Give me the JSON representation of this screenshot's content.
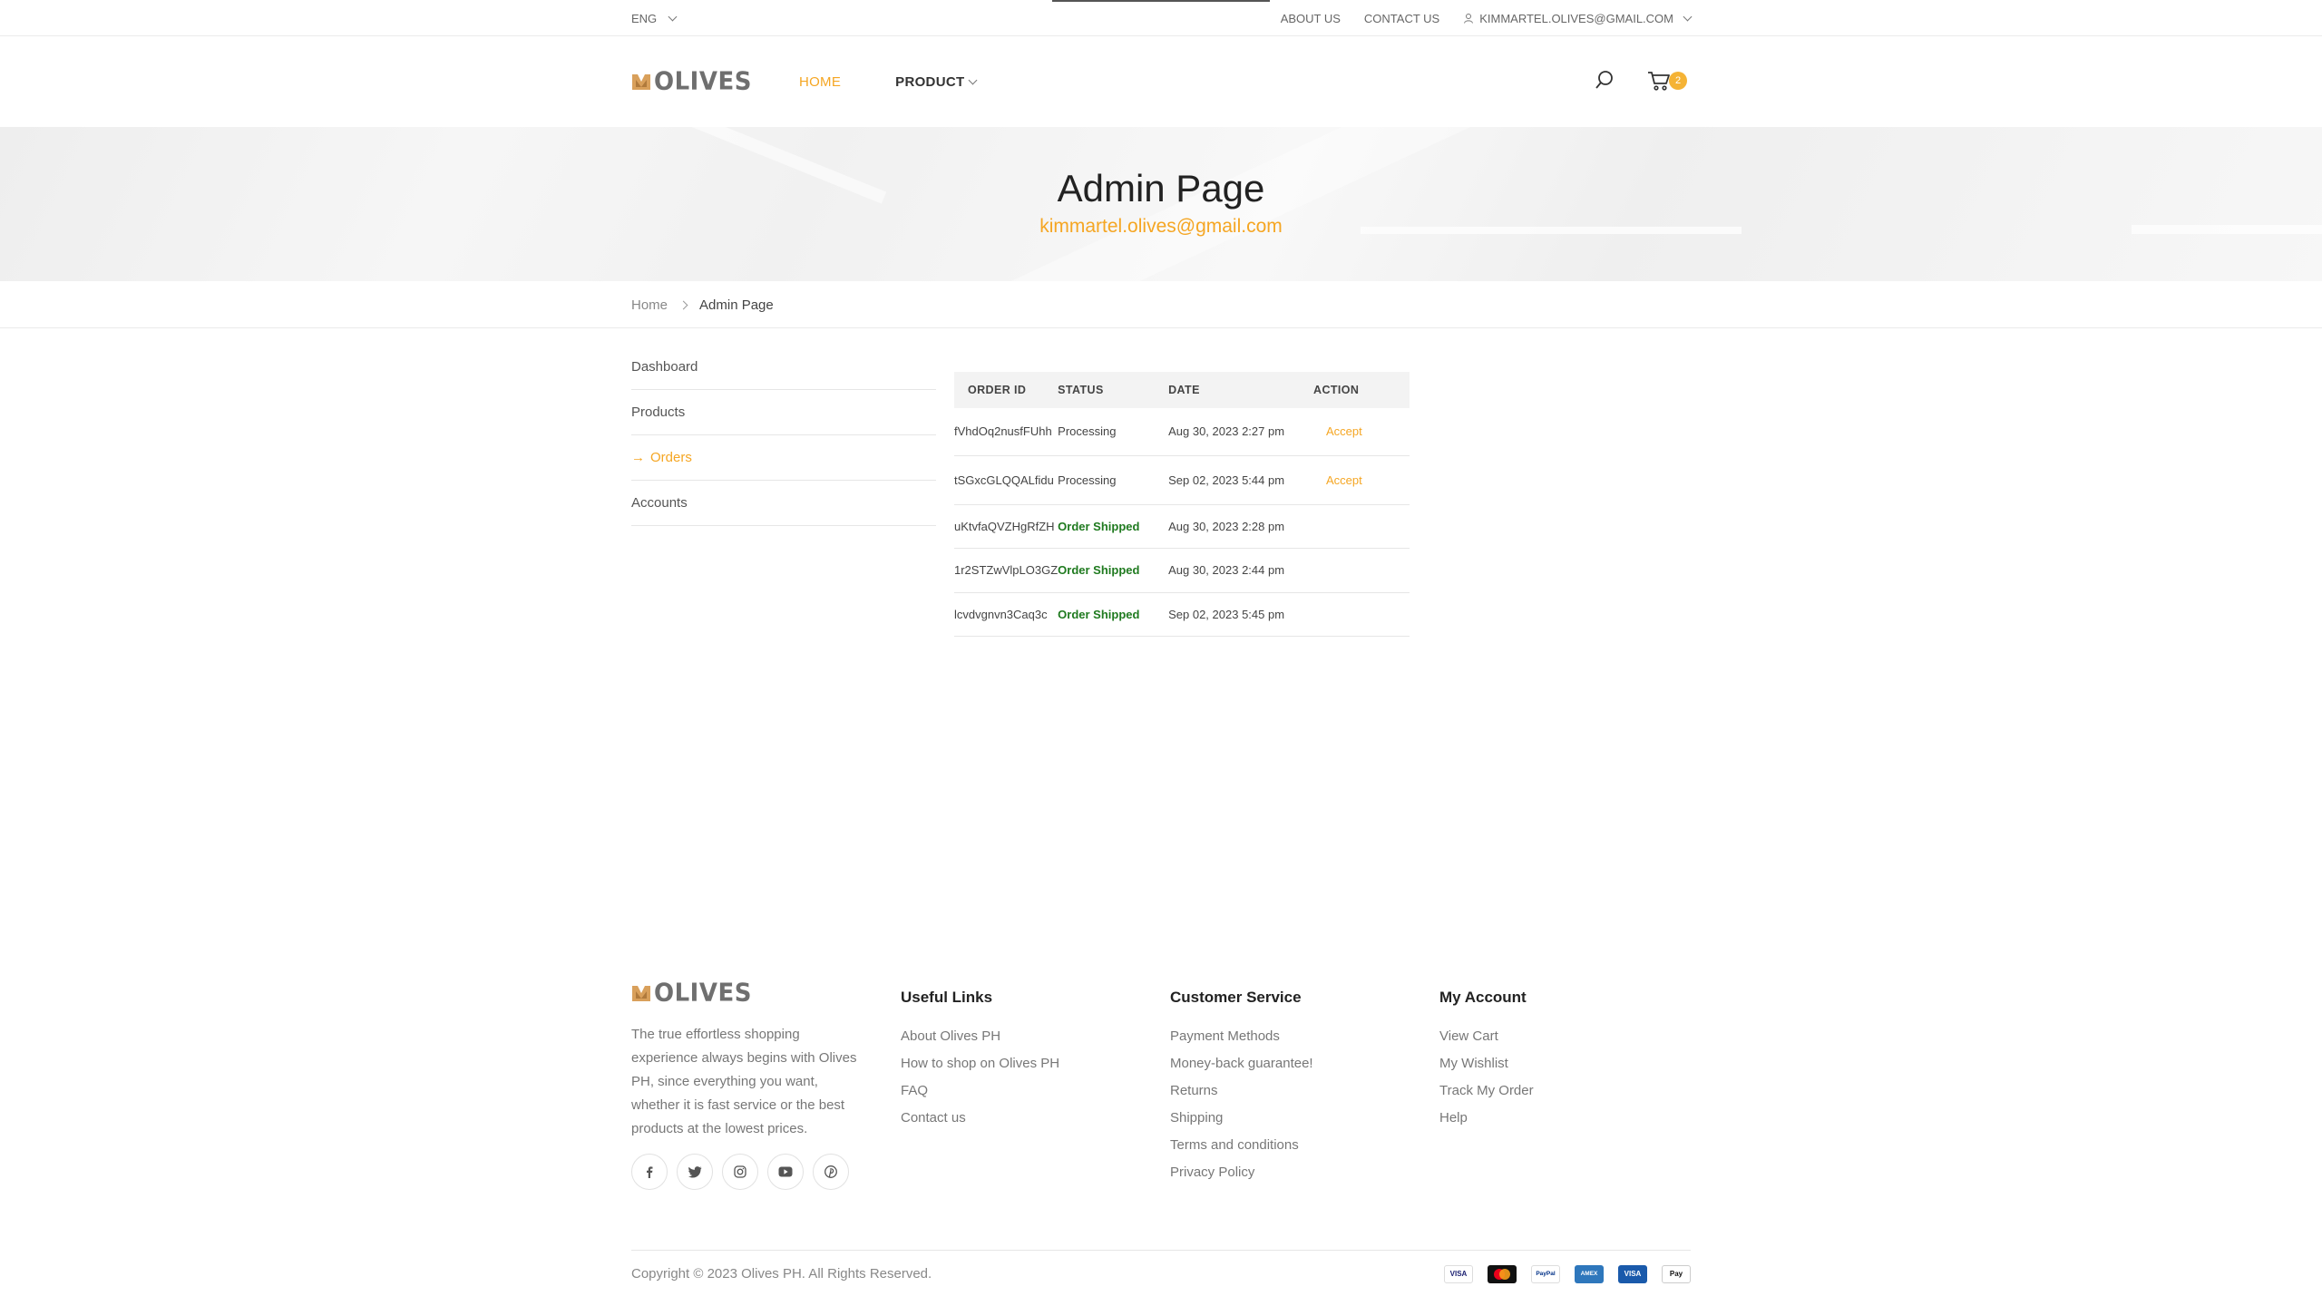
{
  "topbar": {
    "language": "ENG",
    "about": "ABOUT US",
    "contact": "CONTACT US",
    "user_email": "KIMMARTEL.OLIVES@GMAIL.COM"
  },
  "header": {
    "logo_text": "OLIVES",
    "nav": [
      {
        "label": "HOME",
        "active": true
      },
      {
        "label": "PRODUCT",
        "active": false
      }
    ],
    "cart_count": "2"
  },
  "hero": {
    "title": "Admin Page",
    "email": "kimmartel.olives@gmail.com"
  },
  "breadcrumb": {
    "home": "Home",
    "current": "Admin Page"
  },
  "sidebar": {
    "items": [
      {
        "label": "Dashboard"
      },
      {
        "label": "Products"
      },
      {
        "label": "Orders",
        "arrow": "→"
      },
      {
        "label": "Accounts"
      }
    ]
  },
  "orders": {
    "headers": [
      "ORDER ID",
      "STATUS",
      "DATE",
      "ACTION"
    ],
    "rows": [
      {
        "id": "fVhdOq2nusfFUhh",
        "status": "Processing",
        "date": "Aug 30, 2023 2:27 pm",
        "action": "Accept"
      },
      {
        "id": "tSGxcGLQQALfidu",
        "status": "Processing",
        "date": "Sep 02, 2023 5:44 pm",
        "action": "Accept"
      },
      {
        "id": "uKtvfaQVZHgRfZH",
        "status": "Order Shipped",
        "date": "Aug 30, 2023 2:28 pm",
        "action": ""
      },
      {
        "id": "1r2STZwVlpLO3GZ",
        "status": "Order Shipped",
        "date": "Aug 30, 2023 2:44 pm",
        "action": ""
      },
      {
        "id": "lcvdvgnvn3Caq3c",
        "status": "Order Shipped",
        "date": "Sep 02, 2023 5:45 pm",
        "action": ""
      }
    ]
  },
  "footer": {
    "logo_text": "OLIVES",
    "about": "The true effortless shopping experience always begins with Olives PH, since everything you want, whether it is fast service or the best products at the lowest prices.",
    "socials": [
      "facebook-icon",
      "twitter-icon",
      "instagram-icon",
      "youtube-icon",
      "pinterest-icon"
    ],
    "useful_links": {
      "title": "Useful Links",
      "links": [
        "About Olives PH",
        "How to shop on Olives PH",
        "FAQ",
        "Contact us"
      ]
    },
    "customer_service": {
      "title": "Customer Service",
      "links": [
        "Payment Methods",
        "Money-back guarantee!",
        "Returns",
        "Shipping",
        "Terms and conditions",
        "Privacy Policy"
      ]
    },
    "my_account": {
      "title": "My Account",
      "links": [
        "View Cart",
        "My Wishlist",
        "Track My Order",
        "Help"
      ]
    },
    "copyright": "Copyright © 2023 Olives PH. All Rights Reserved.",
    "payments": [
      "VISA",
      "mastercard",
      "PayPal",
      "AMEX",
      "VISA",
      "Pay"
    ]
  },
  "colors": {
    "accent": "#f5a623",
    "shipped": "#1f7a1f"
  }
}
